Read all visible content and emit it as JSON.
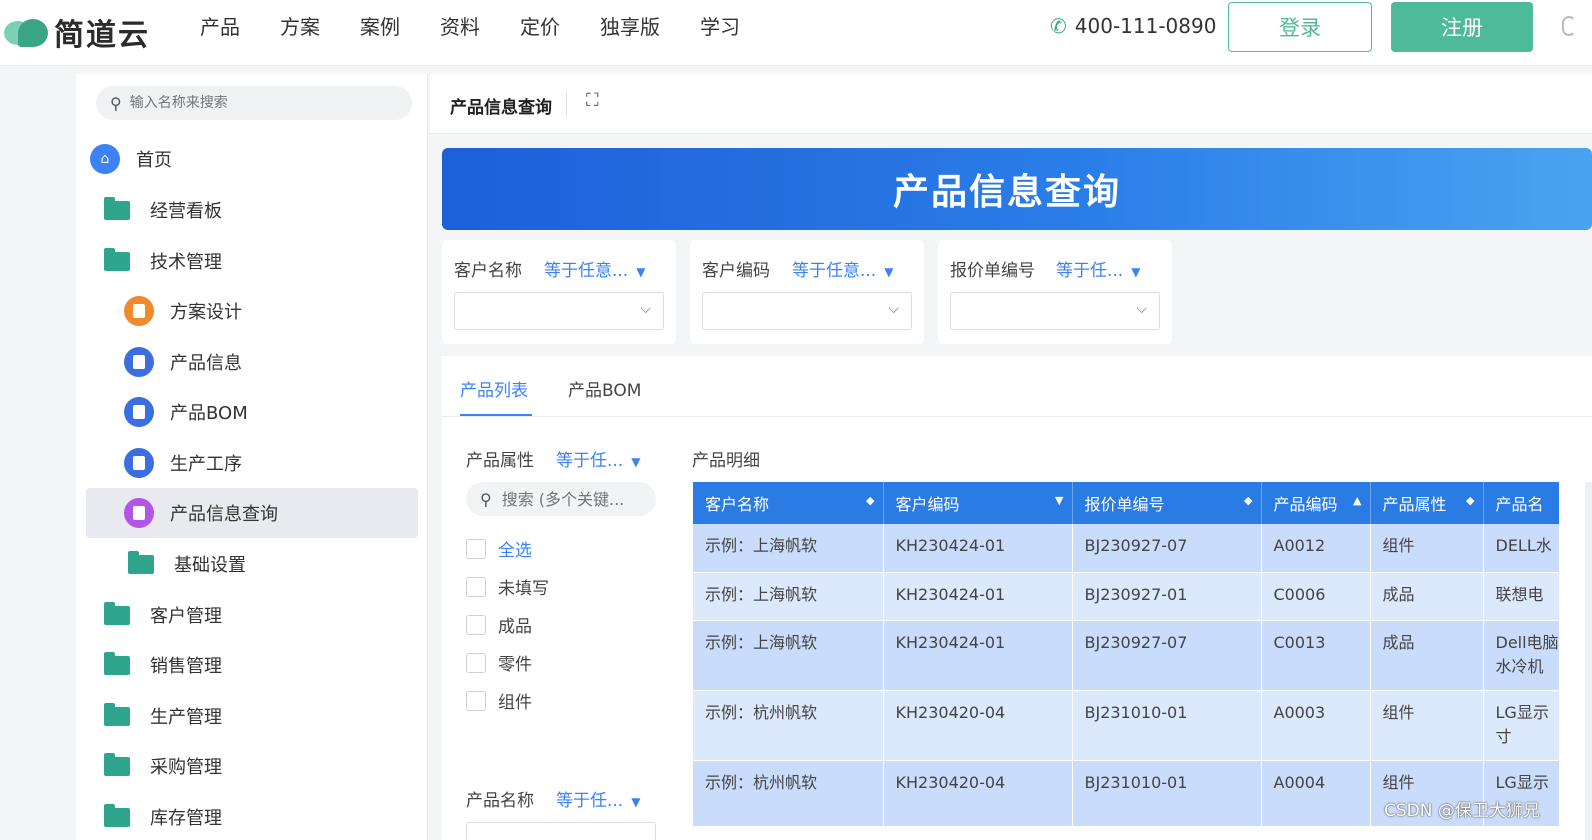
{
  "brand": {
    "name": "简道云"
  },
  "nav": [
    "产品",
    "方案",
    "案例",
    "资料",
    "定价",
    "独享版",
    "学习"
  ],
  "header": {
    "phone": "400-111-0890",
    "login": "登录",
    "register": "注册"
  },
  "sidebar": {
    "search_placeholder": "输入名称来搜索",
    "items": [
      {
        "label": "首页",
        "icon": "home-icon",
        "color": "#3b82f6"
      },
      {
        "label": "经营看板",
        "icon": "folder-icon",
        "color": "#2fa58e"
      },
      {
        "label": "技术管理",
        "icon": "folder-icon",
        "color": "#2fa58e"
      },
      {
        "label": "方案设计",
        "icon": "form-icon",
        "color": "#f08a2c"
      },
      {
        "label": "产品信息",
        "icon": "form-icon",
        "color": "#3b6fe0"
      },
      {
        "label": "产品BOM",
        "icon": "org-icon",
        "color": "#3b6fe0"
      },
      {
        "label": "生产工序",
        "icon": "form-icon",
        "color": "#3b6fe0"
      },
      {
        "label": "产品信息查询",
        "icon": "report-icon",
        "color": "#b455e6",
        "active": true
      },
      {
        "label": "基础设置",
        "icon": "folder-icon",
        "color": "#2fa58e"
      },
      {
        "label": "客户管理",
        "icon": "folder-icon",
        "color": "#2fa58e"
      },
      {
        "label": "销售管理",
        "icon": "folder-icon",
        "color": "#2fa58e"
      },
      {
        "label": "生产管理",
        "icon": "folder-icon",
        "color": "#2fa58e"
      },
      {
        "label": "采购管理",
        "icon": "folder-icon",
        "color": "#2fa58e"
      },
      {
        "label": "库存管理",
        "icon": "folder-icon",
        "color": "#2fa58e"
      }
    ]
  },
  "main": {
    "page_tab": "产品信息查询",
    "banner_title": "产品信息查询",
    "filters": [
      {
        "label": "客户名称",
        "op": "等于任意..."
      },
      {
        "label": "客户编码",
        "op": "等于任意..."
      },
      {
        "label": "报价单编号",
        "op": "等于任..."
      }
    ],
    "tabs": [
      "产品列表",
      "产品BOM"
    ],
    "attr_filter": {
      "label": "产品属性",
      "op": "等于任...",
      "search_placeholder": "搜索 (多个关键..."
    },
    "checkboxes": [
      "全选",
      "未填写",
      "成品",
      "零件",
      "组件"
    ],
    "name_filter": {
      "label": "产品名称",
      "op": "等于任..."
    },
    "detail_title": "产品明细",
    "table": {
      "columns": [
        "客户名称",
        "客户编码",
        "报价单编号",
        "产品编码",
        "产品属性",
        "产品名"
      ],
      "rows": [
        [
          "示例：上海帆软",
          "KH230424-01",
          "BJ230927-07",
          "A0012",
          "组件",
          "DELL水"
        ],
        [
          "示例：上海帆软",
          "KH230424-01",
          "BJ230927-01",
          "C0006",
          "成品",
          "联想电"
        ],
        [
          "示例：上海帆软",
          "KH230424-01",
          "BJ230927-07",
          "C0013",
          "成品",
          "Dell电脑\n水冷机"
        ],
        [
          "示例：杭州帆软",
          "KH230420-04",
          "BJ231010-01",
          "A0003",
          "组件",
          "LG显示\n寸"
        ],
        [
          "示例：杭州帆软",
          "KH230420-04",
          "BJ231010-01",
          "A0004",
          "组件",
          "LG显示"
        ]
      ]
    }
  },
  "watermark": "CSDN @保卫大狮兄"
}
